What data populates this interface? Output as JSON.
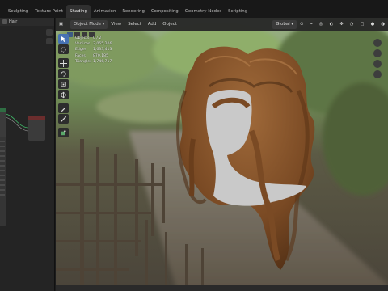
{
  "workspace_tabs": [
    {
      "label": "Sculpting",
      "active": false
    },
    {
      "label": "Texture Paint",
      "active": false
    },
    {
      "label": "Shading",
      "active": true
    },
    {
      "label": "Animation",
      "active": false
    },
    {
      "label": "Rendering",
      "active": false
    },
    {
      "label": "Compositing",
      "active": false
    },
    {
      "label": "Geometry Nodes",
      "active": false
    },
    {
      "label": "Scripting",
      "active": false
    }
  ],
  "node_editor": {
    "object_label": "Hair"
  },
  "viewport": {
    "mode_label": "Object Mode",
    "menus": [
      "View",
      "Select",
      "Add",
      "Object"
    ],
    "transform_orientation": "Global",
    "stats": [
      {
        "label": "Objects",
        "value": "0 / 2"
      },
      {
        "label": "Vertices",
        "value": "3,065,206"
      },
      {
        "label": "Edges",
        "value": "1,633,413"
      },
      {
        "label": "Faces",
        "value": "870,185"
      },
      {
        "label": "Triangles",
        "value": "1,746,717"
      }
    ]
  },
  "colors": {
    "accent": "#4772b3",
    "hair": "#7a4a24",
    "head": "#c9c9c9"
  }
}
